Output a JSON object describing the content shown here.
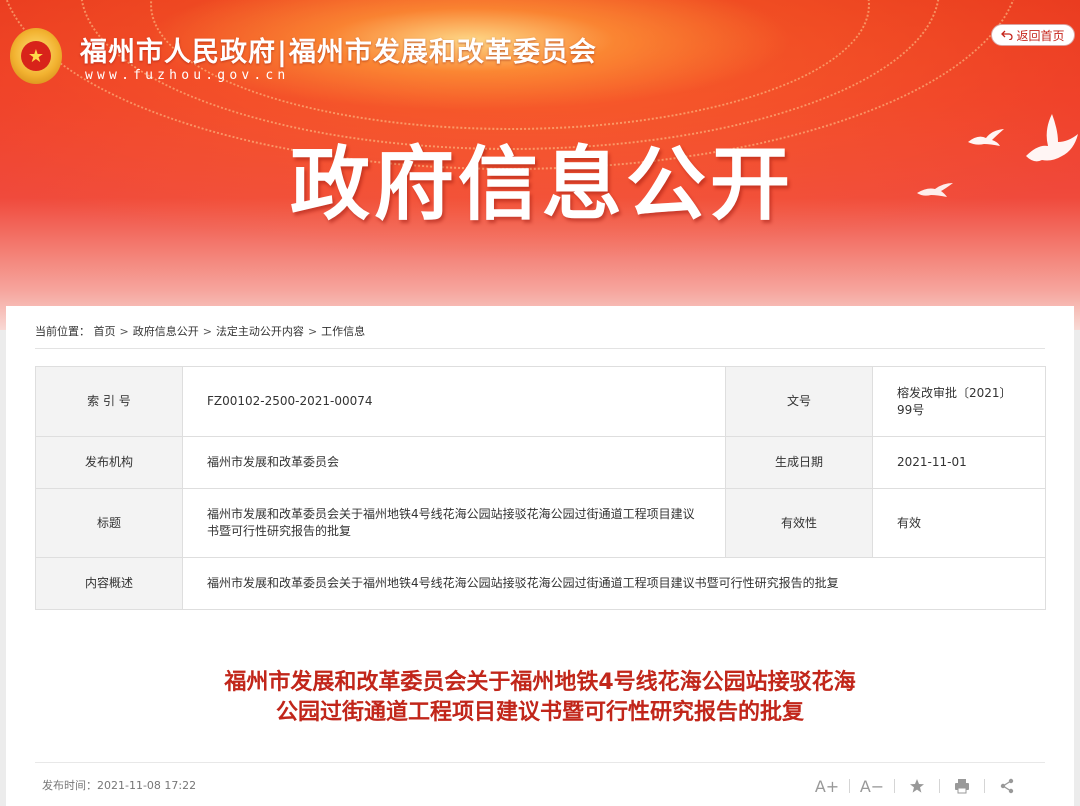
{
  "header": {
    "site_title_left": "福州市人民政府",
    "site_title_sep": "|",
    "site_title_right": "福州市发展和改革委员会",
    "site_url": "www.fuzhou.gov.cn",
    "home_button_label": "返回首页",
    "banner_heading": "政府信息公开"
  },
  "breadcrumb": {
    "prefix": "当前位置：",
    "items": [
      "首页",
      "政府信息公开",
      "法定主动公开内容",
      "工作信息"
    ],
    "arrow": ">"
  },
  "info": {
    "index_label": "索 引 号",
    "index_value": "FZ00102-2500-2021-00074",
    "doc_no_label": "文号",
    "doc_no_value": "榕发改审批〔2021〕99号",
    "publisher_label": "发布机构",
    "publisher_value": "福州市发展和改革委员会",
    "date_label": "生成日期",
    "date_value": "2021-11-01",
    "title_label": "标题",
    "title_value": "福州市发展和改革委员会关于福州地铁4号线花海公园站接驳花海公园过街通道工程项目建议书暨可行性研究报告的批复",
    "validity_label": "有效性",
    "validity_value": "有效",
    "summary_label": "内容概述",
    "summary_value": "福州市发展和改革委员会关于福州地铁4号线花海公园站接驳花海公园过街通道工程项目建议书暨可行性研究报告的批复"
  },
  "article": {
    "title_line1": "福州市发展和改革委员会关于福州地铁4号线花海公园站接驳花海",
    "title_line2": "公园过街通道工程项目建议书暨可行性研究报告的批复",
    "publish_time": "发布时间：2021-11-08 17:22"
  },
  "tools": {
    "font_increase": "A+",
    "font_decrease": "A−"
  },
  "colors": {
    "banner_red": "#e8361f",
    "title_red": "#c1261a",
    "label_bg": "#f3f3f3"
  }
}
